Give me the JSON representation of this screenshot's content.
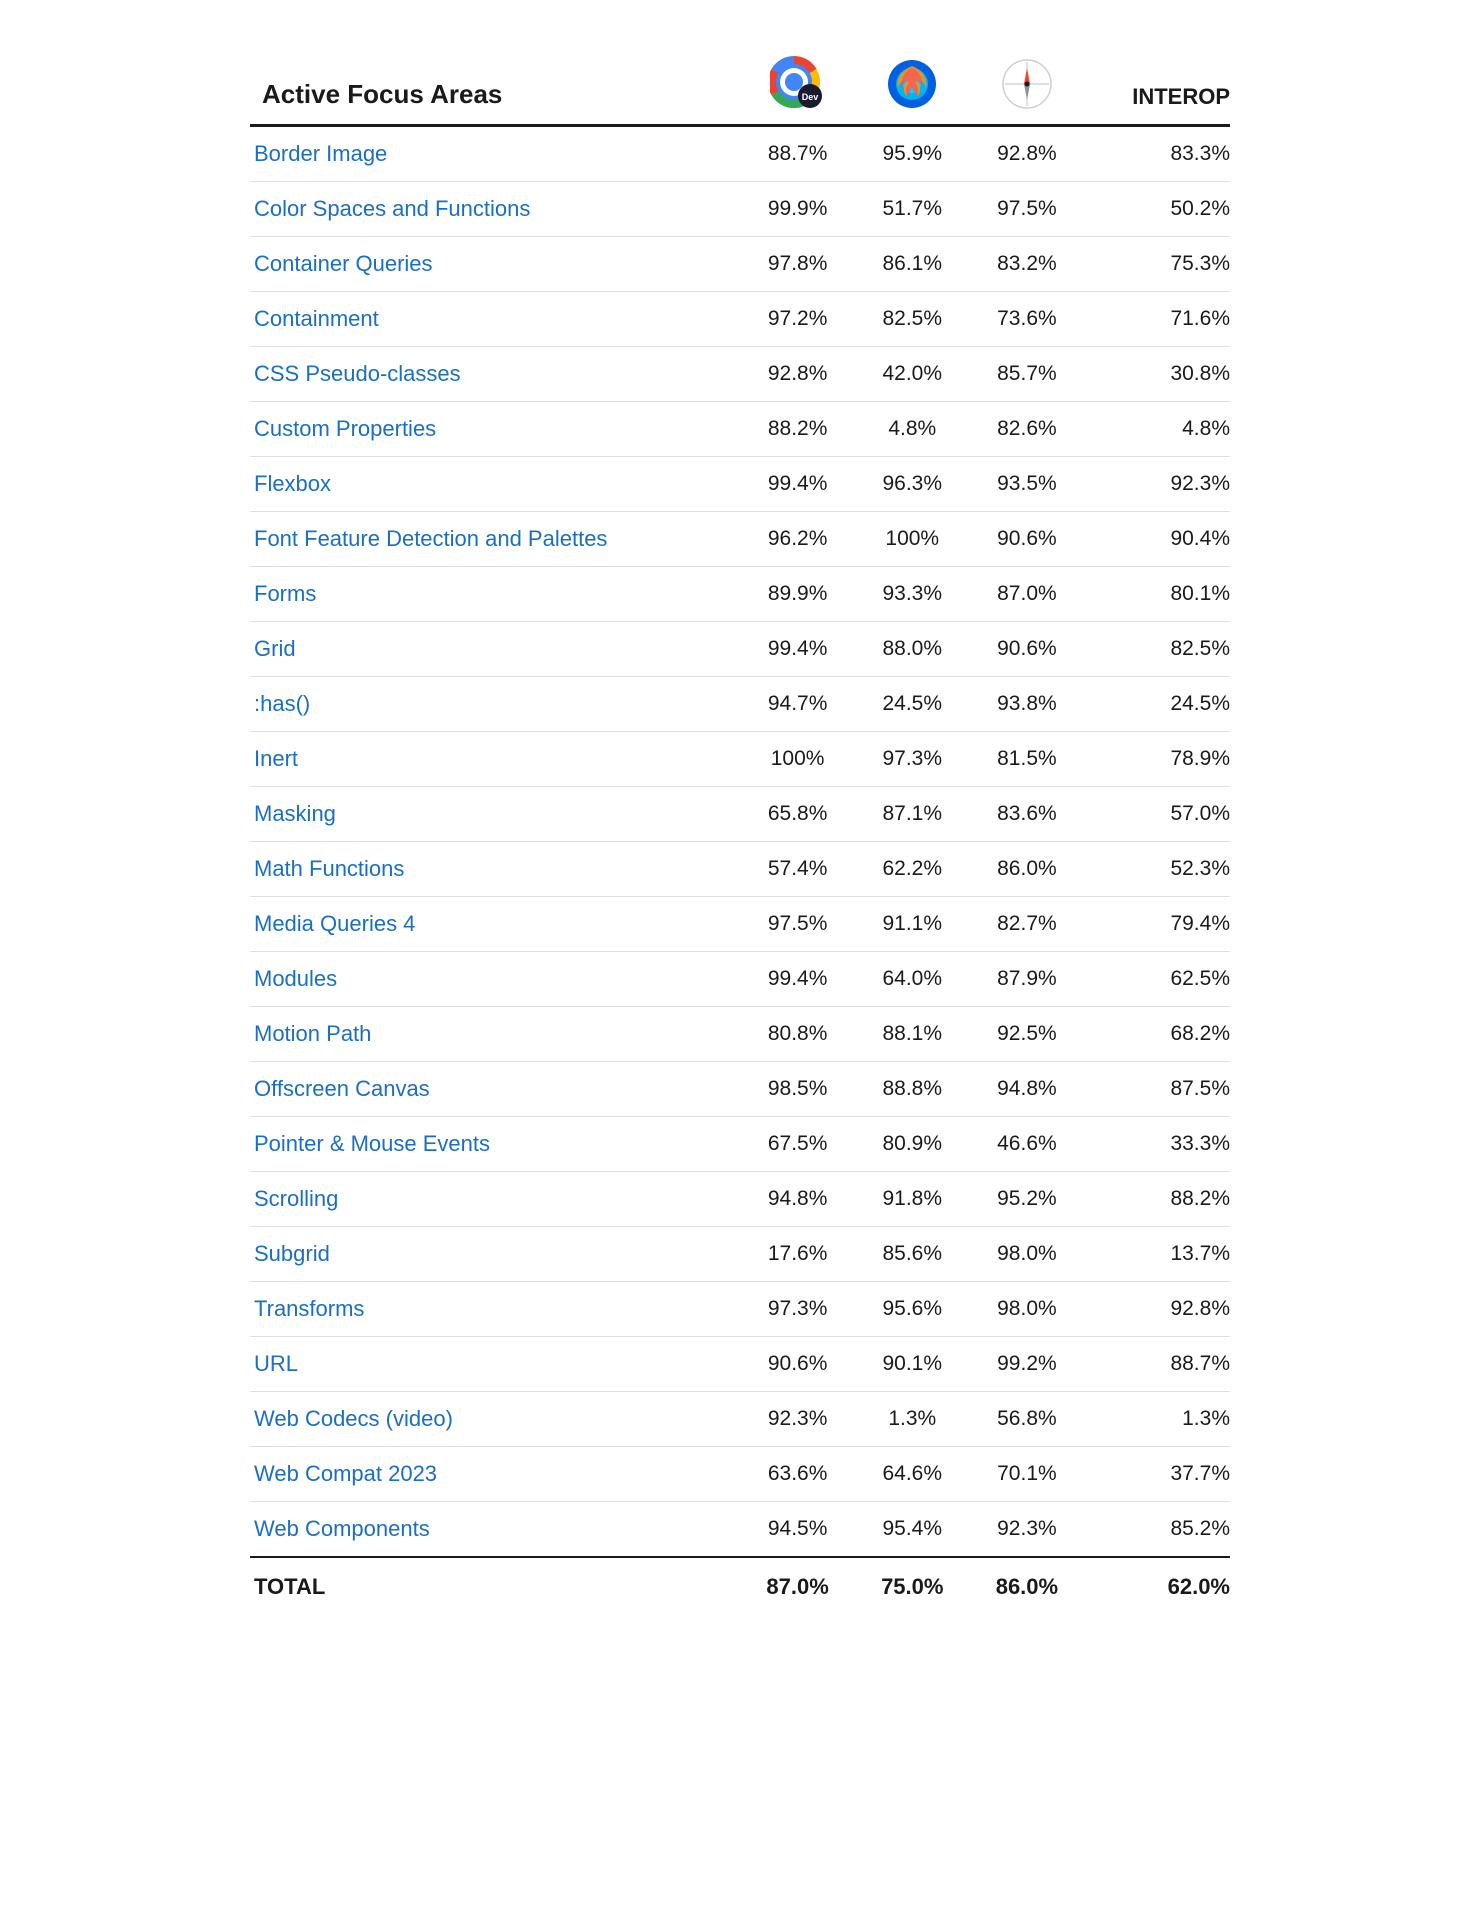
{
  "header": {
    "col1": "Active Focus Areas",
    "col4": "INTEROP",
    "browser1_label": "Chrome Dev",
    "browser2_label": "Firefox",
    "browser3_label": "Safari"
  },
  "rows": [
    {
      "name": "Border Image",
      "v1": "88.7%",
      "v2": "95.9%",
      "v3": "92.8%",
      "v4": "83.3%"
    },
    {
      "name": "Color Spaces and Functions",
      "v1": "99.9%",
      "v2": "51.7%",
      "v3": "97.5%",
      "v4": "50.2%"
    },
    {
      "name": "Container Queries",
      "v1": "97.8%",
      "v2": "86.1%",
      "v3": "83.2%",
      "v4": "75.3%"
    },
    {
      "name": "Containment",
      "v1": "97.2%",
      "v2": "82.5%",
      "v3": "73.6%",
      "v4": "71.6%"
    },
    {
      "name": "CSS Pseudo-classes",
      "v1": "92.8%",
      "v2": "42.0%",
      "v3": "85.7%",
      "v4": "30.8%"
    },
    {
      "name": "Custom Properties",
      "v1": "88.2%",
      "v2": "4.8%",
      "v3": "82.6%",
      "v4": "4.8%"
    },
    {
      "name": "Flexbox",
      "v1": "99.4%",
      "v2": "96.3%",
      "v3": "93.5%",
      "v4": "92.3%"
    },
    {
      "name": "Font Feature Detection and Palettes",
      "v1": "96.2%",
      "v2": "100%",
      "v3": "90.6%",
      "v4": "90.4%"
    },
    {
      "name": "Forms",
      "v1": "89.9%",
      "v2": "93.3%",
      "v3": "87.0%",
      "v4": "80.1%"
    },
    {
      "name": "Grid",
      "v1": "99.4%",
      "v2": "88.0%",
      "v3": "90.6%",
      "v4": "82.5%"
    },
    {
      "name": ":has()",
      "v1": "94.7%",
      "v2": "24.5%",
      "v3": "93.8%",
      "v4": "24.5%"
    },
    {
      "name": "Inert",
      "v1": "100%",
      "v2": "97.3%",
      "v3": "81.5%",
      "v4": "78.9%"
    },
    {
      "name": "Masking",
      "v1": "65.8%",
      "v2": "87.1%",
      "v3": "83.6%",
      "v4": "57.0%"
    },
    {
      "name": "Math Functions",
      "v1": "57.4%",
      "v2": "62.2%",
      "v3": "86.0%",
      "v4": "52.3%"
    },
    {
      "name": "Media Queries 4",
      "v1": "97.5%",
      "v2": "91.1%",
      "v3": "82.7%",
      "v4": "79.4%"
    },
    {
      "name": "Modules",
      "v1": "99.4%",
      "v2": "64.0%",
      "v3": "87.9%",
      "v4": "62.5%"
    },
    {
      "name": "Motion Path",
      "v1": "80.8%",
      "v2": "88.1%",
      "v3": "92.5%",
      "v4": "68.2%"
    },
    {
      "name": "Offscreen Canvas",
      "v1": "98.5%",
      "v2": "88.8%",
      "v3": "94.8%",
      "v4": "87.5%"
    },
    {
      "name": "Pointer & Mouse Events",
      "v1": "67.5%",
      "v2": "80.9%",
      "v3": "46.6%",
      "v4": "33.3%"
    },
    {
      "name": "Scrolling",
      "v1": "94.8%",
      "v2": "91.8%",
      "v3": "95.2%",
      "v4": "88.2%"
    },
    {
      "name": "Subgrid",
      "v1": "17.6%",
      "v2": "85.6%",
      "v3": "98.0%",
      "v4": "13.7%"
    },
    {
      "name": "Transforms",
      "v1": "97.3%",
      "v2": "95.6%",
      "v3": "98.0%",
      "v4": "92.8%"
    },
    {
      "name": "URL",
      "v1": "90.6%",
      "v2": "90.1%",
      "v3": "99.2%",
      "v4": "88.7%"
    },
    {
      "name": "Web Codecs (video)",
      "v1": "92.3%",
      "v2": "1.3%",
      "v3": "56.8%",
      "v4": "1.3%"
    },
    {
      "name": "Web Compat 2023",
      "v1": "63.6%",
      "v2": "64.6%",
      "v3": "70.1%",
      "v4": "37.7%"
    },
    {
      "name": "Web Components",
      "v1": "94.5%",
      "v2": "95.4%",
      "v3": "92.3%",
      "v4": "85.2%"
    }
  ],
  "footer": {
    "label": "TOTAL",
    "v1": "87.0%",
    "v2": "75.0%",
    "v3": "86.0%",
    "v4": "62.0%"
  }
}
